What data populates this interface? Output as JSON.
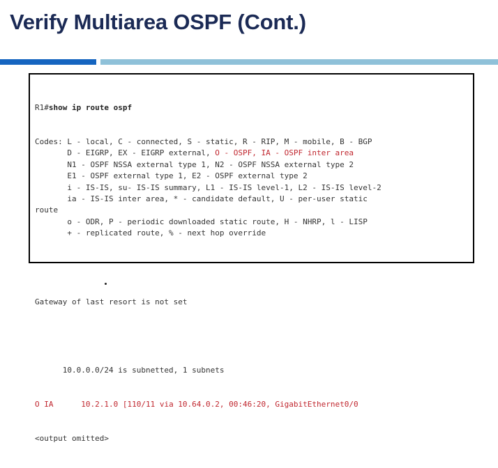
{
  "slide": {
    "title": "Verify Multiarea OSPF (Cont.)"
  },
  "terminal": {
    "prompt": "R1#",
    "command": "show ip route ospf",
    "codes": [
      [
        {
          "t": "Codes: L - local, C - connected, S - static, R - RIP, M - mobile, B - BGP"
        }
      ],
      [
        {
          "t": "       D - EIGRP, EX - EIGRP external, "
        },
        {
          "t": "O - OSPF, IA - OSPF inter area",
          "red": true
        }
      ],
      [
        {
          "t": "       N1 - OSPF NSSA external type 1, N2 - OSPF NSSA external type 2"
        }
      ],
      [
        {
          "t": "       E1 - OSPF external type 1, E2 - OSPF external type 2"
        }
      ],
      [
        {
          "t": "       i - IS-IS, su- IS-IS summary, L1 - IS-IS level-1, L2 - IS-IS level-2"
        }
      ],
      [
        {
          "t": "       ia - IS-IS inter area, * - candidate default, U - per-user static"
        }
      ],
      [
        {
          "t": "route"
        }
      ],
      [
        {
          "t": "       o - ODR, P - periodic downloaded static route, H - NHRP, l - LISP"
        }
      ],
      [
        {
          "t": "       + - replicated route, % - next hop override"
        }
      ]
    ],
    "gateway": "Gateway of last resort is not set",
    "subnet_line": "      10.0.0.0/24 is subnetted, 1 subnets",
    "route": {
      "code": "O IA",
      "detail": "      10.2.1.0 [110/11 via 10.64.0.2, 00:46:20, GigabitEthernet0/0"
    },
    "omitted": "<output omitted>"
  },
  "colors": {
    "title": "#1b2a55",
    "accent_dark": "#1565c0",
    "accent_light": "#8fc1d9",
    "highlight": "#c0262e"
  }
}
